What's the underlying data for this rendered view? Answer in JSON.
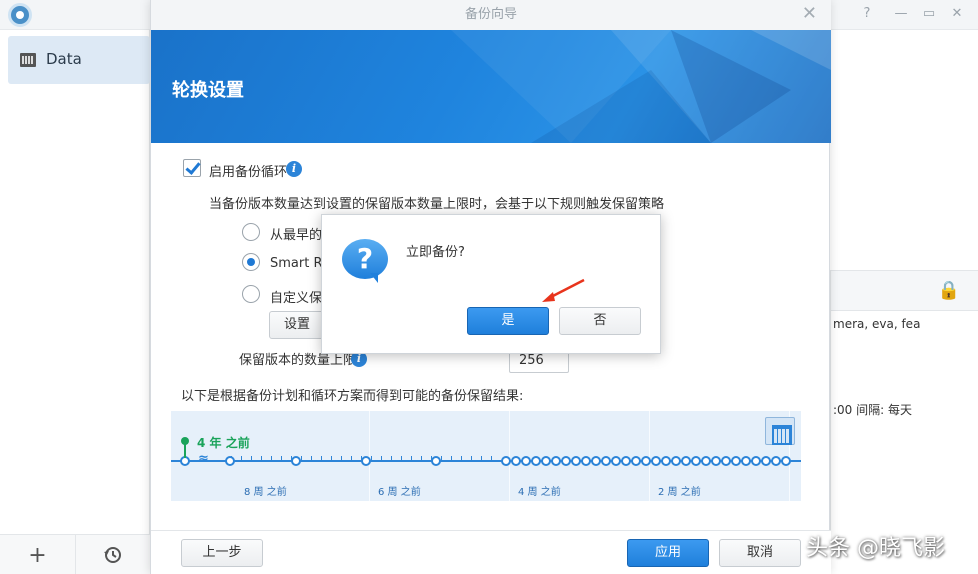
{
  "app": {
    "sidebar_item": "Data",
    "right_panel_lines": [
      "mera, eva, fea",
      ":00 间隔: 每天"
    ]
  },
  "wizard": {
    "window_title": "备份向导",
    "banner_title": "轮换设置",
    "enable_rotation_label": "启用备份循环",
    "description": "当备份版本数量达到设置的保留版本数量上限时，会基于以下规则触发保留策略",
    "options": [
      {
        "label": "从最早的",
        "selected": false
      },
      {
        "label": "Smart Re",
        "selected": true
      },
      {
        "label": "自定义保",
        "selected": false
      }
    ],
    "settings_button": "设置",
    "max_versions_label": "保留版本的数量上限",
    "max_versions_value": "256",
    "result_caption": "以下是根据备份计划和循环方案而得到可能的备份保留结果:",
    "timeline": {
      "start_label": "4 年 之前",
      "labels": [
        "8 周 之前",
        "6 周 之前",
        "4 周 之前",
        "2 周 之前"
      ]
    },
    "back_button": "上一步",
    "apply_button": "应用",
    "cancel_button": "取消"
  },
  "dialog": {
    "message": "立即备份?",
    "yes_button": "是",
    "no_button": "否"
  },
  "watermark": "头条 @晓飞影",
  "colors": {
    "accent": "#1f7fdb",
    "timeline_bg": "#e6f0fa",
    "green": "#1aa35a"
  }
}
